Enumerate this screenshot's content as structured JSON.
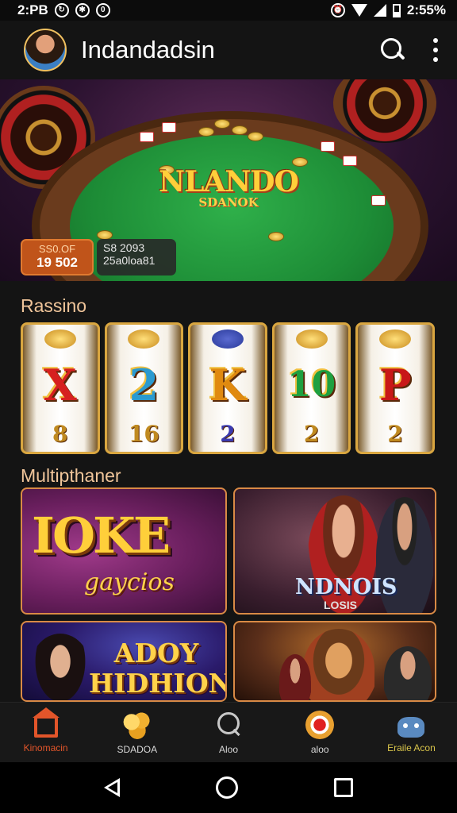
{
  "status_bar": {
    "time": "2:PB",
    "battery": "2:55%"
  },
  "app_bar": {
    "title": "Indandadsin"
  },
  "hero": {
    "logo_main": "NLANDO",
    "logo_sub": "SDANOK",
    "jackpot_badge": {
      "line1": "SS0.OF",
      "line2": "19 502"
    },
    "bet_badge": {
      "line1": "S8 2093",
      "line2": "25a0loa81"
    }
  },
  "sections": {
    "casino_label": "Rassino",
    "multiplayer_label": "Multipthaner"
  },
  "reels": [
    {
      "symbol": "X",
      "bottom": "8",
      "color": "#d62020"
    },
    {
      "symbol": "2",
      "bottom": "16",
      "color": "#2a9ad0"
    },
    {
      "symbol": "K",
      "bottom": "2",
      "color": "#e08a10"
    },
    {
      "symbol": "10",
      "bottom": "2",
      "color": "#1ea040"
    },
    {
      "symbol": "P",
      "bottom": "2",
      "color": "#c81818"
    }
  ],
  "games": {
    "card1": {
      "title": "IOKE",
      "subtitle": "gaycios"
    },
    "card2": {
      "title": "NDNOIS",
      "subtitle": "LOSIS"
    },
    "card3": {
      "title_line1": "ADOY",
      "title_line2": "HIDHION"
    },
    "card4": {}
  },
  "bottom_nav": [
    {
      "label": "Kinomacin",
      "icon": "home-icon"
    },
    {
      "label": "SDADOA",
      "icon": "coins-icon"
    },
    {
      "label": "Aloo",
      "icon": "search-icon"
    },
    {
      "label": "aloo",
      "icon": "chip-icon"
    },
    {
      "label": "Eraile Acon",
      "icon": "robot-icon"
    }
  ],
  "colors": {
    "accent": "#e2552a",
    "gold": "#ffcf3a",
    "background": "#141414"
  }
}
